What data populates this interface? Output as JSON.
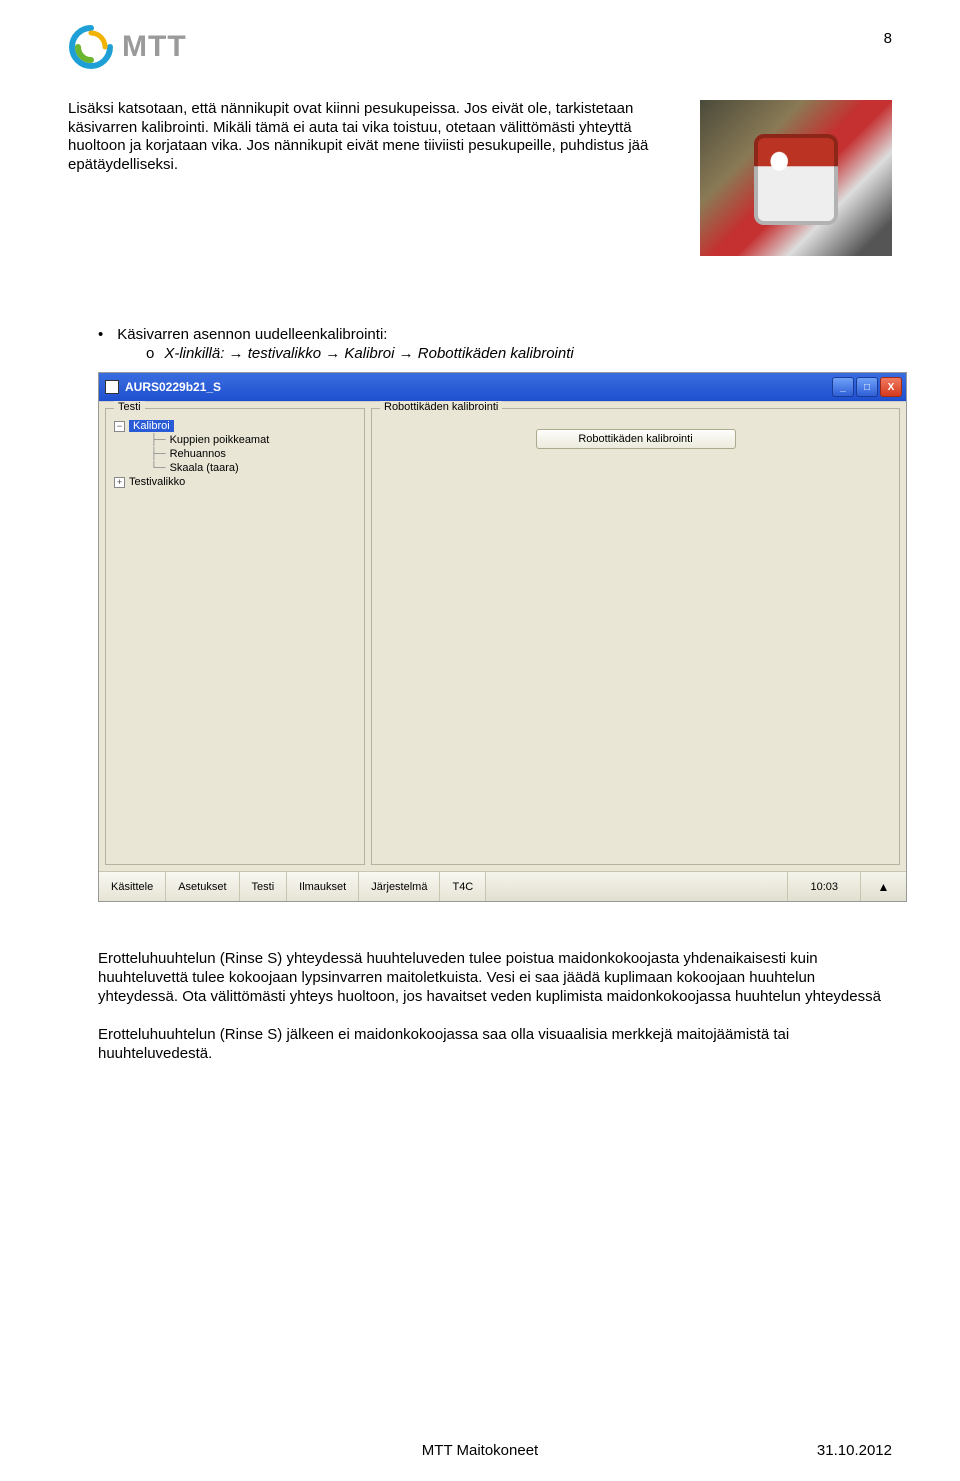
{
  "page_number": "8",
  "logo_text": "MTT",
  "intro_paragraph": "Lisäksi katsotaan, että nännikupit ovat kiinni pesukupeissa. Jos eivät ole, tarkistetaan käsivarren kalibrointi. Mikäli tämä ei auta tai vika toistuu, otetaan välittömästi yhteyttä huoltoon ja korjataan vika. Jos nännikupit eivät mene tiiviisti pesukupeille, puhdistus jää epätäydelliseksi.",
  "bullet": {
    "marker": "•",
    "text": "Käsivarren asennon uudelleenkalibrointi:",
    "sub_marker": "o",
    "sub_text_prefix": "X-linkillä:",
    "nav1": "testivalikko",
    "nav2": "Kalibroi",
    "nav3": "Robottikäden kalibrointi",
    "arrow": "→"
  },
  "window": {
    "title": "AURS0229b21_S",
    "btn_min": "_",
    "btn_max": "□",
    "btn_close": "X",
    "left_legend": "Testi",
    "right_legend": "Robottikäden kalibrointi",
    "tree": {
      "minus": "−",
      "plus": "+",
      "root": "Kalibroi",
      "child1": "Kuppien poikkeamat",
      "child2": "Rehuannos",
      "child3": "Skaala (taara)",
      "sibling": "Testivalikko"
    },
    "calibrate_button": "Robottikäden kalibrointi",
    "statusbar": {
      "b1": "Käsittele",
      "b2": "Asetukset",
      "b3": "Testi",
      "b4": "Ilmaukset",
      "b5": "Järjestelmä",
      "b6": "T4C",
      "time": "10:03",
      "tri": "▲"
    }
  },
  "para2": "Erotteluhuuhtelun (Rinse S) yhteydessä huuhteluveden tulee poistua maidonkokoojasta yhdenaikaisesti kuin huuhteluvettä tulee kokoojaan lypsinvarren maitoletkuista. Vesi ei saa jäädä kuplimaan kokoojaan huuhtelun yhteydessä. Ota välittömästi yhteys huoltoon, jos havaitset veden kuplimista maidonkokoojassa huuhtelun yhteydessä",
  "para3": "Erotteluhuuhtelun (Rinse S) jälkeen ei maidonkokoojassa saa olla visuaalisia merkkejä maitojäämistä tai huuhteluvedestä.",
  "footer": {
    "center": "MTT Maitokoneet",
    "right": "31.10.2012"
  }
}
